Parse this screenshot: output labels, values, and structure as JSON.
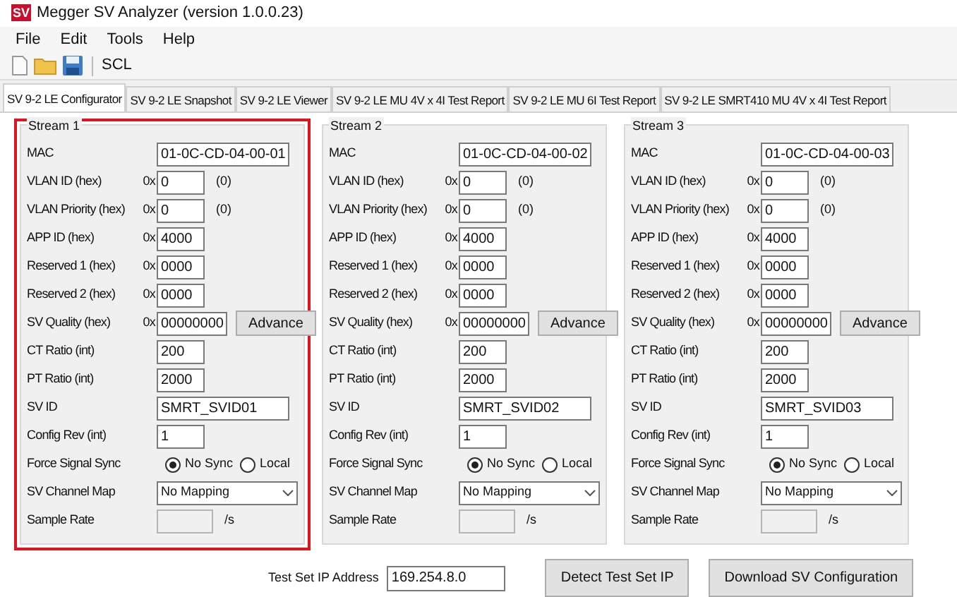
{
  "window": {
    "logo": "SV",
    "title": "Megger SV Analyzer (version 1.0.0.23)"
  },
  "menu": [
    "File",
    "Edit",
    "Tools",
    "Help"
  ],
  "toolbar": {
    "label": "SCL"
  },
  "tabs": [
    {
      "label": "SV 9-2 LE Configurator",
      "selected": true
    },
    {
      "label": "SV 9-2 LE Snapshot",
      "selected": false
    },
    {
      "label": "SV 9-2 LE Viewer",
      "selected": false
    },
    {
      "label": "SV 9-2 LE MU 4V x 4I Test Report",
      "selected": false
    },
    {
      "label": "SV 9-2 LE MU 6I Test Report",
      "selected": false
    },
    {
      "label": "SV 9-2 LE SMRT410 MU 4V x 4I Test Report",
      "selected": false
    }
  ],
  "streams": [
    {
      "title": "Stream 1",
      "highlighted": true,
      "rows": [
        {
          "kind": "wide",
          "label": "MAC",
          "value": "01-0C-CD-04-00-01"
        },
        {
          "kind": "hex",
          "label": "VLAN ID (hex)",
          "prefix": "0x",
          "value": "0",
          "note": "(0)"
        },
        {
          "kind": "hex",
          "label": "VLAN Priority (hex)",
          "prefix": "0x",
          "value": "0",
          "note": "(0)"
        },
        {
          "kind": "hex",
          "label": "APP ID (hex)",
          "prefix": "0x",
          "value": "4000"
        },
        {
          "kind": "hex",
          "label": "Reserved 1 (hex)",
          "prefix": "0x",
          "value": "0000"
        },
        {
          "kind": "hex",
          "label": "Reserved 2 (hex)",
          "prefix": "0x",
          "value": "0000"
        },
        {
          "kind": "hex",
          "label": "SV Quality (hex)",
          "prefix": "0x",
          "value": "00000000",
          "button": "Advance"
        },
        {
          "kind": "short",
          "label": "CT Ratio (int)",
          "value": "200"
        },
        {
          "kind": "short",
          "label": "PT Ratio (int)",
          "value": "2000"
        },
        {
          "kind": "wide",
          "label": "SV ID",
          "value": "SMRT_SVID01"
        },
        {
          "kind": "short",
          "label": "Config Rev (int)",
          "value": "1"
        },
        {
          "kind": "radio",
          "label": "Force Signal Sync",
          "options": [
            {
              "label": "No Sync",
              "selected": true
            },
            {
              "label": "Local",
              "selected": false
            }
          ]
        },
        {
          "kind": "select",
          "label": "SV Channel Map",
          "value": "No Mapping"
        },
        {
          "kind": "rate",
          "label": "Sample Rate",
          "unit": "/s",
          "disabled": true
        }
      ]
    },
    {
      "title": "Stream 2",
      "highlighted": false,
      "rows": [
        {
          "kind": "wide",
          "label": "MAC",
          "value": "01-0C-CD-04-00-02"
        },
        {
          "kind": "hex",
          "label": "VLAN ID (hex)",
          "prefix": "0x",
          "value": "0",
          "note": "(0)"
        },
        {
          "kind": "hex",
          "label": "VLAN Priority (hex)",
          "prefix": "0x",
          "value": "0",
          "note": "(0)"
        },
        {
          "kind": "hex",
          "label": "APP ID (hex)",
          "prefix": "0x",
          "value": "4000"
        },
        {
          "kind": "hex",
          "label": "Reserved 1 (hex)",
          "prefix": "0x",
          "value": "0000"
        },
        {
          "kind": "hex",
          "label": "Reserved 2 (hex)",
          "prefix": "0x",
          "value": "0000"
        },
        {
          "kind": "hex",
          "label": "SV Quality (hex)",
          "prefix": "0x",
          "value": "00000000",
          "button": "Advance"
        },
        {
          "kind": "short",
          "label": "CT Ratio (int)",
          "value": "200"
        },
        {
          "kind": "short",
          "label": "PT Ratio (int)",
          "value": "2000"
        },
        {
          "kind": "wide",
          "label": "SV ID",
          "value": "SMRT_SVID02"
        },
        {
          "kind": "short",
          "label": "Config Rev (int)",
          "value": "1"
        },
        {
          "kind": "radio",
          "label": "Force Signal Sync",
          "options": [
            {
              "label": "No Sync",
              "selected": true
            },
            {
              "label": "Local",
              "selected": false
            }
          ]
        },
        {
          "kind": "select",
          "label": "SV Channel Map",
          "value": "No Mapping"
        },
        {
          "kind": "rate",
          "label": "Sample Rate",
          "unit": "/s",
          "disabled": true
        }
      ]
    },
    {
      "title": "Stream 3",
      "highlighted": false,
      "rows": [
        {
          "kind": "wide",
          "label": "MAC",
          "value": "01-0C-CD-04-00-03"
        },
        {
          "kind": "hex",
          "label": "VLAN ID (hex)",
          "prefix": "0x",
          "value": "0",
          "note": "(0)"
        },
        {
          "kind": "hex",
          "label": "VLAN Priority (hex)",
          "prefix": "0x",
          "value": "0",
          "note": "(0)"
        },
        {
          "kind": "hex",
          "label": "APP ID (hex)",
          "prefix": "0x",
          "value": "4000"
        },
        {
          "kind": "hex",
          "label": "Reserved 1 (hex)",
          "prefix": "0x",
          "value": "0000"
        },
        {
          "kind": "hex",
          "label": "Reserved 2 (hex)",
          "prefix": "0x",
          "value": "0000"
        },
        {
          "kind": "hex",
          "label": "SV Quality (hex)",
          "prefix": "0x",
          "value": "00000000",
          "button": "Advance"
        },
        {
          "kind": "short",
          "label": "CT Ratio (int)",
          "value": "200"
        },
        {
          "kind": "short",
          "label": "PT Ratio (int)",
          "value": "2000"
        },
        {
          "kind": "wide",
          "label": "SV ID",
          "value": "SMRT_SVID03"
        },
        {
          "kind": "short",
          "label": "Config Rev (int)",
          "value": "1"
        },
        {
          "kind": "radio",
          "label": "Force Signal Sync",
          "options": [
            {
              "label": "No Sync",
              "selected": true
            },
            {
              "label": "Local",
              "selected": false
            }
          ]
        },
        {
          "kind": "select",
          "label": "SV Channel Map",
          "value": "No Mapping"
        },
        {
          "kind": "rate",
          "label": "Sample Rate",
          "unit": "/s",
          "disabled": true
        }
      ]
    }
  ],
  "footer": {
    "ip_label": "Test Set IP Address",
    "ip_value": "169.254.8.0",
    "buttons": [
      "Detect Test Set IP",
      "Download SV Configuration"
    ]
  }
}
